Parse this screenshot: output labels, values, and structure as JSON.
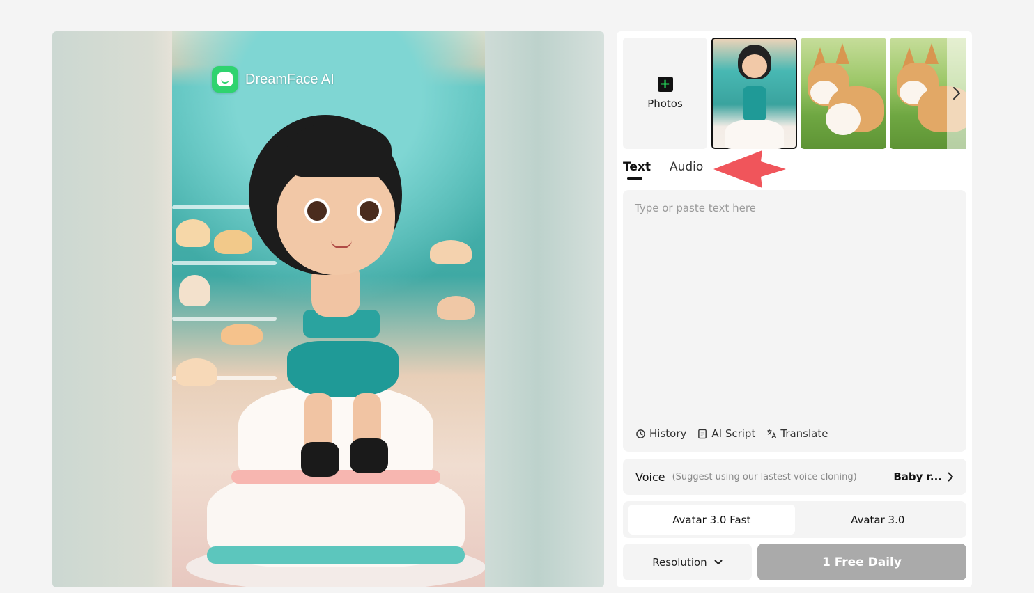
{
  "preview": {
    "watermark": "DreamFace AI"
  },
  "photos": {
    "add_label": "Photos",
    "thumbnails": [
      {
        "name": "avatar-girl-on-cake",
        "selected": true
      },
      {
        "name": "corgi-running",
        "selected": false
      },
      {
        "name": "corgi-running-2",
        "selected": false
      }
    ]
  },
  "tabs": [
    {
      "label": "Text",
      "active": true
    },
    {
      "label": "Audio",
      "active": false
    }
  ],
  "text_input": {
    "placeholder": "Type or paste text here",
    "value": ""
  },
  "tools": {
    "history": "History",
    "ai_script": "AI Script",
    "translate": "Translate"
  },
  "voice": {
    "label": "Voice",
    "hint": "(Suggest using our lastest voice cloning)",
    "value": "Baby r..."
  },
  "models": [
    {
      "label": "Avatar 3.0 Fast",
      "active": true
    },
    {
      "label": "Avatar 3.0",
      "active": false
    }
  ],
  "resolution": {
    "label": "Resolution"
  },
  "generate": {
    "label": "1 Free Daily"
  },
  "colors": {
    "accent_arrow": "#f0555b",
    "generate_disabled": "#aaaaaa",
    "plus_green": "#25e05c"
  }
}
